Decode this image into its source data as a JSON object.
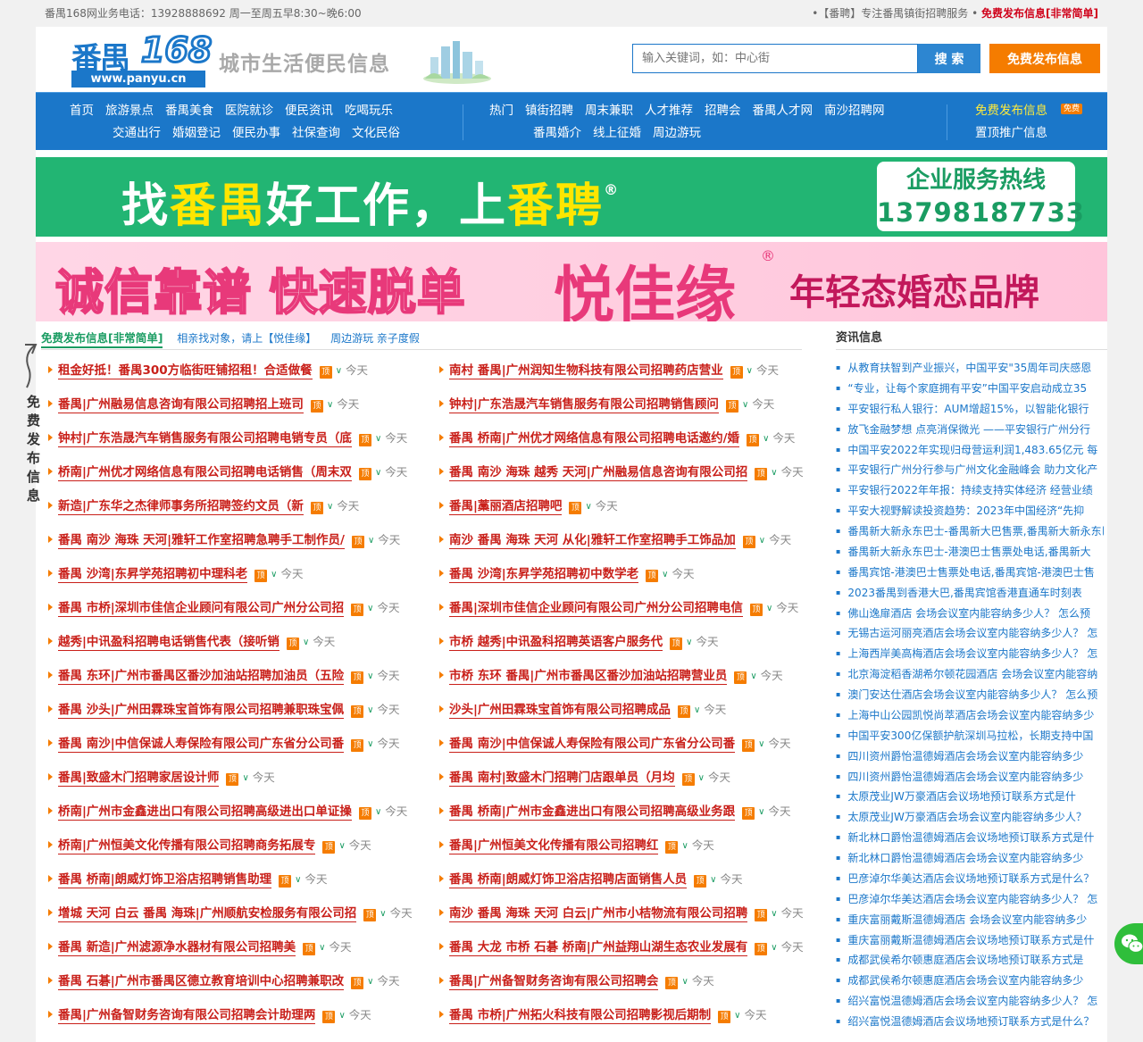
{
  "topbar": {
    "left": "番禺168网业务电话：13928888692    周一至周五早8:30~晚6:00",
    "right_text": "•【番聘】专注番禺镇街招聘服务 •",
    "right_link": "免费发布信息[非常简单]"
  },
  "header": {
    "logo_cn": "番禺",
    "logo_num": "168",
    "logo_url": "www.panyu.cn",
    "slogan": "城市生活便民信息",
    "search_placeholder": "输入关键词，如：中心街",
    "search_button": "搜 索",
    "post_button": "免费发布信息"
  },
  "nav": {
    "group1_row1": [
      "首页",
      "旅游景点",
      "番禺美食",
      "医院就诊",
      "便民资讯",
      "吃喝玩乐"
    ],
    "group1_row2": [
      "交通出行",
      "婚姻登记",
      "便民办事",
      "社保查询",
      "文化民俗"
    ],
    "group2_row1": [
      "热门",
      "镇街招聘",
      "周末兼职",
      "人才推荐",
      "招聘会",
      "番禺人才网",
      "南沙招聘网"
    ],
    "group2_row2": [
      "番禺婚介",
      "线上征婚",
      "周边游玩"
    ],
    "group3_row1": "免费发布信息",
    "group3_badge": "免费",
    "group3_row2": "置顶推广信息"
  },
  "banner1": {
    "part1": "找",
    "part2": "番禺",
    "part3": "好工作，上",
    "part4": "番聘",
    "reg": "®",
    "hotline_label": "企业服务热线",
    "hotline_number": "13798187733"
  },
  "banner2": {
    "part1": "诚信靠谱 快速脱单",
    "part2": "悦佳缘",
    "reg": "®",
    "part3": "年轻态婚恋品牌"
  },
  "tabs": {
    "active": "免费发布信息[非常简单]",
    "others": [
      "相亲找对象，请上【悦佳缘】",
      "周边游玩 亲子度假"
    ]
  },
  "sidetag": "免费发布信息",
  "listing": {
    "ding_label": "顶",
    "date_label": "今天",
    "rows": [
      [
        "租金好抵！番禺300方临街旺铺招租！合适做餐",
        "南村 番禺|广州润知生物科技有限公司招聘药店营业"
      ],
      [
        "番禺|广州融易信息咨询有限公司招聘招上班司",
        "钟村|广东浩晟汽车销售服务有限公司招聘销售顾问"
      ],
      [
        "钟村|广东浩晟汽车销售服务有限公司招聘电销专员（底",
        "番禺 桥南|广州优才网络信息有限公司招聘电话邀约/婚"
      ],
      [
        "桥南|广州优才网络信息有限公司招聘电话销售（周末双",
        "番禺 南沙 海珠 越秀 天河|广州融易信息咨询有限公司招"
      ],
      [
        "新造|广东华之杰律师事务所招聘签约文员（新",
        "番禺|藁丽酒店招聘吧"
      ],
      [
        "番禺 南沙 海珠 天河|雅轩工作室招聘急聘手工制作员/",
        "南沙 番禺 海珠 天河 从化|雅轩工作室招聘手工饰品加"
      ],
      [
        "番禺 沙湾|东昇学苑招聘初中理科老",
        "番禺 沙湾|东昇学苑招聘初中数学老"
      ],
      [
        "番禺 市桥|深圳市佳信企业顾问有限公司广州分公司招",
        "番禺|深圳市佳信企业顾问有限公司广州分公司招聘电信"
      ],
      [
        "越秀|中讯盈科招聘电话销售代表（接听销",
        "市桥 越秀|中讯盈科招聘英语客户服务代"
      ],
      [
        "番禺 东环|广州市番禺区番沙加油站招聘加油员（五险",
        "市桥 东环 番禺|广州市番禺区番沙加油站招聘营业员"
      ],
      [
        "番禺 沙头|广州田霖珠宝首饰有限公司招聘兼职珠宝佩",
        "沙头|广州田霖珠宝首饰有限公司招聘成品"
      ],
      [
        "番禺 南沙|中信保诚人寿保险有限公司广东省分公司番",
        "番禺 南沙|中信保诚人寿保险有限公司广东省分公司番"
      ],
      [
        "番禺|致盛木门招聘家居设计师",
        "番禺 南村|致盛木门招聘门店跟单员（月均"
      ],
      [
        "桥南|广州市金鑫进出口有限公司招聘高级进出口单证操",
        "番禺 桥南|广州市金鑫进出口有限公司招聘高级业务跟"
      ],
      [
        "桥南|广州恒美文化传播有限公司招聘商务拓展专",
        "番禺|广州恒美文化传播有限公司招聘红"
      ],
      [
        "番禺 桥南|朗威灯饰卫浴店招聘销售助理",
        "番禺 桥南|朗威灯饰卫浴店招聘店面销售人员"
      ],
      [
        "增城 天河 白云 番禺 海珠|广州顺航安检服务有限公司招",
        "南沙 番禺 海珠 天河 白云|广州市小桔物流有限公司招聘"
      ],
      [
        "番禺 新造|广州滤源净水器材有限公司招聘美",
        "番禺 大龙 市桥 石碁 桥南|广州益翔山湖生态农业发展有"
      ],
      [
        "番禺 石碁|广州市番禺区德立教育培训中心招聘兼职改",
        "番禺|广州备智财务咨询有限公司招聘会"
      ],
      [
        "番禺|广州备智财务咨询有限公司招聘会计助理两",
        "番禺 市桥|广州拓火科技有限公司招聘影视后期制"
      ]
    ]
  },
  "news": {
    "title": "资讯信息",
    "items": [
      "从教育扶智到产业振兴，中国平安\"35周年司庆感恩",
      "“专业，让每个家庭拥有平安”中国平安启动成立35",
      "平安银行私人银行：AUM增超15%，以智能化银行",
      "放飞金融梦想 点亮消保微光 ——平安银行广州分行",
      "中国平安2022年实现归母营运利润1,483.65亿元 每",
      "平安银行广州分行参与广州文化金融峰会 助力文化产",
      "平安银行2022年年报：持续支持实体经济 经营业绩",
      "平安大视野解读投资趋势：2023年中国经济“先抑",
      "番禺新大新永东巴士-番禺新大巴售票,番禺新大新永东巴",
      "番禺新大新永东巴士-港澳巴士售票处电话,番禺新大",
      "番禺宾馆-港澳巴士售票处电话,番禺宾馆-港澳巴士售",
      "2023番禺到香港大巴,番禺宾馆香港直通车时刻表",
      "佛山逸扉酒店 会场会议室内能容纳多少人？ 怎么预",
      "无锡古运河丽亮酒店会场会议室内能容纳多少人？ 怎",
      "上海西岸美高梅酒店会场会议室内能容纳多少人？ 怎",
      "北京海淀稻香湖希尔顿花园酒店 会场会议室内能容纳",
      "澳门安达仕酒店会场会议室内能容纳多少人？ 怎么预",
      "上海中山公园凯悦尚萃酒店会场会议室内能容纳多少",
      "中国平安300亿保额护航深圳马拉松，长期支持中国",
      "四川资州爵怡温德姆酒店会场会议室内能容纳多少",
      "四川资州爵怡温德姆酒店会场会议室内能容纳多少",
      "太原茂业JW万豪酒店会议场地预订联系方式是什",
      "太原茂业JW万豪酒店会场会议室内能容纳多少人？",
      "新北林口爵怡温德姆酒店会议场地预订联系方式是什",
      "新北林口爵怡温德姆酒店会场会议室内能容纳多少",
      "巴彦淖尔华美达酒店会议场地预订联系方式是什么？",
      "巴彦淖尔华美达酒店会场会议室内能容纳多少人？ 怎",
      "重庆富丽戴斯温德姆酒店 会场会议室内能容纳多少",
      "重庆富丽戴斯温德姆酒店会议场地预订联系方式是什",
      "成都武侯希尔顿惠庭酒店会议场地预订联系方式是",
      "成都武侯希尔顿惠庭酒店会场会议室内能容纳多少",
      "绍兴富悦温德姆酒店会场会议室内能容纳多少人？ 怎",
      "绍兴富悦温德姆酒店会议场地预订联系方式是什么？"
    ]
  },
  "colors": {
    "brand_blue": "#1b77c9",
    "accent_orange": "#f57c00",
    "green": "#22b573",
    "red_link": "#c9201a"
  }
}
